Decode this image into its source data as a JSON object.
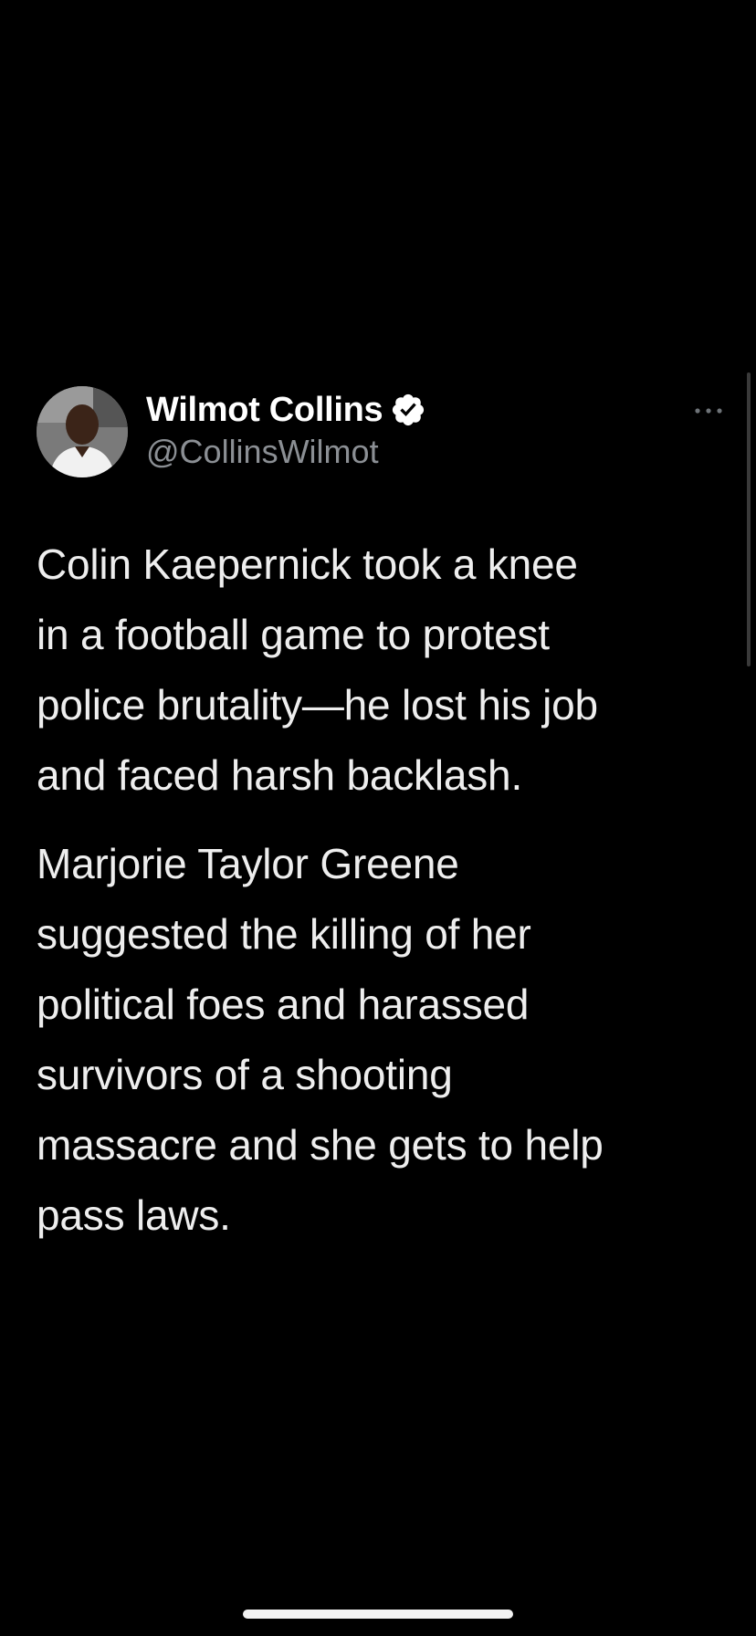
{
  "tweet": {
    "author": {
      "display_name": "Wilmot Collins",
      "handle": "@CollinsWilmot",
      "verified": true,
      "avatar_icon": "person-avatar"
    },
    "menu_icon": "more-horizontal-icon",
    "paragraphs": [
      "Colin Kaepernick took a knee\nin a football game to protest\npolice brutality—he lost his job\nand faced harsh backlash.",
      "Marjorie Taylor Greene\nsuggested the killing of her\npolitical foes and harassed\nsurvivors of a shooting\nmassacre and she gets to help\npass laws."
    ]
  },
  "colors": {
    "background": "#000000",
    "text": "#eeeeee",
    "handle": "#8b8f94",
    "verified_badge": "#ffffff"
  }
}
